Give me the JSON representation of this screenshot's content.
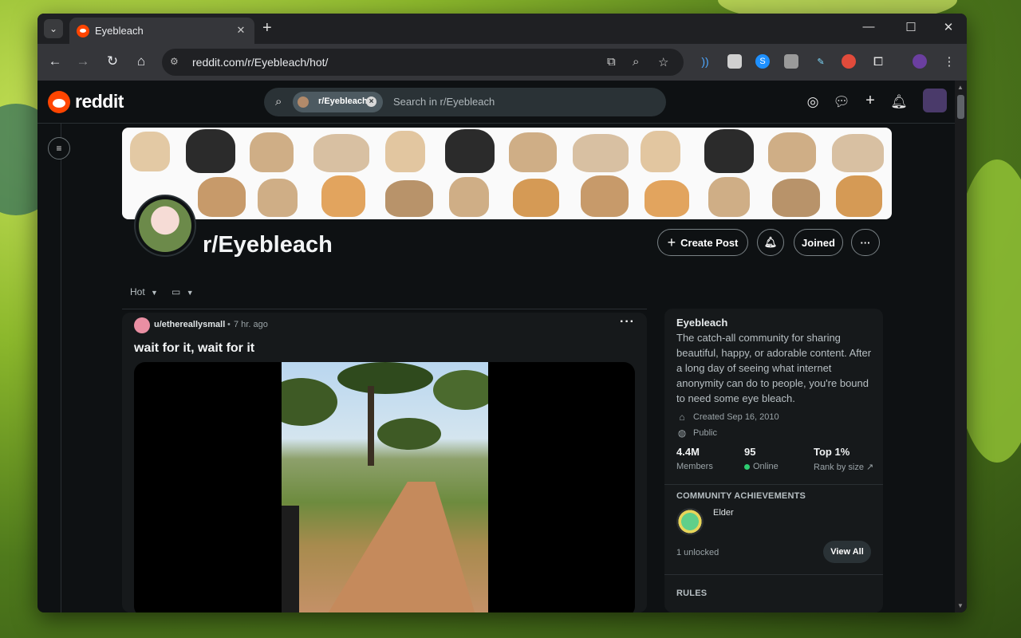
{
  "browser": {
    "tab_title": "Eyebleach",
    "tab_close": "✕",
    "new_tab": "+",
    "url": "reddit.com/r/Eyebleach/hot/",
    "window_controls": {
      "minimize": "—",
      "maximize": "☐",
      "close": "✕"
    }
  },
  "reddit_header": {
    "logo_text": "reddit",
    "search_chip": "r/Eyebleach",
    "search_placeholder": "Search in r/Eyebleach",
    "icons": [
      "advertise-icon",
      "chat-icon",
      "create-icon",
      "notifications-icon",
      "user-avatar"
    ]
  },
  "community": {
    "name": "r/Eyebleach",
    "buttons": {
      "create_post": "Create Post",
      "joined": "Joined",
      "more": "···"
    }
  },
  "sort": {
    "label": "Hot",
    "view": "▭"
  },
  "post": {
    "author": "u/etherеallysmall",
    "separator": "•",
    "time": "7 hr. ago",
    "more": "···",
    "title": "wait for it, wait for it"
  },
  "sidebar": {
    "title": "Eyebleach",
    "description": "The catch-all community for sharing beautiful, happy, or adorable content. After a long day of seeing what internet anonymity can do to people, you're bound to need some eye bleach.",
    "created": "Created Sep 16, 2010",
    "visibility": "Public",
    "stats": [
      {
        "value": "4.4M",
        "label": "Members"
      },
      {
        "value": "95",
        "label": "Online"
      },
      {
        "value": "Top 1%",
        "label": "Rank by size"
      }
    ],
    "achievements_heading": "COMMUNITY ACHIEVEMENTS",
    "achievement_name": "Elder",
    "unlocked": "1 unlocked",
    "view_all": "View All",
    "rules_heading": "RULES"
  },
  "colors": {
    "reddit_orange": "#ff4500",
    "bg": "#0e1113",
    "online": "#2ecc71"
  }
}
